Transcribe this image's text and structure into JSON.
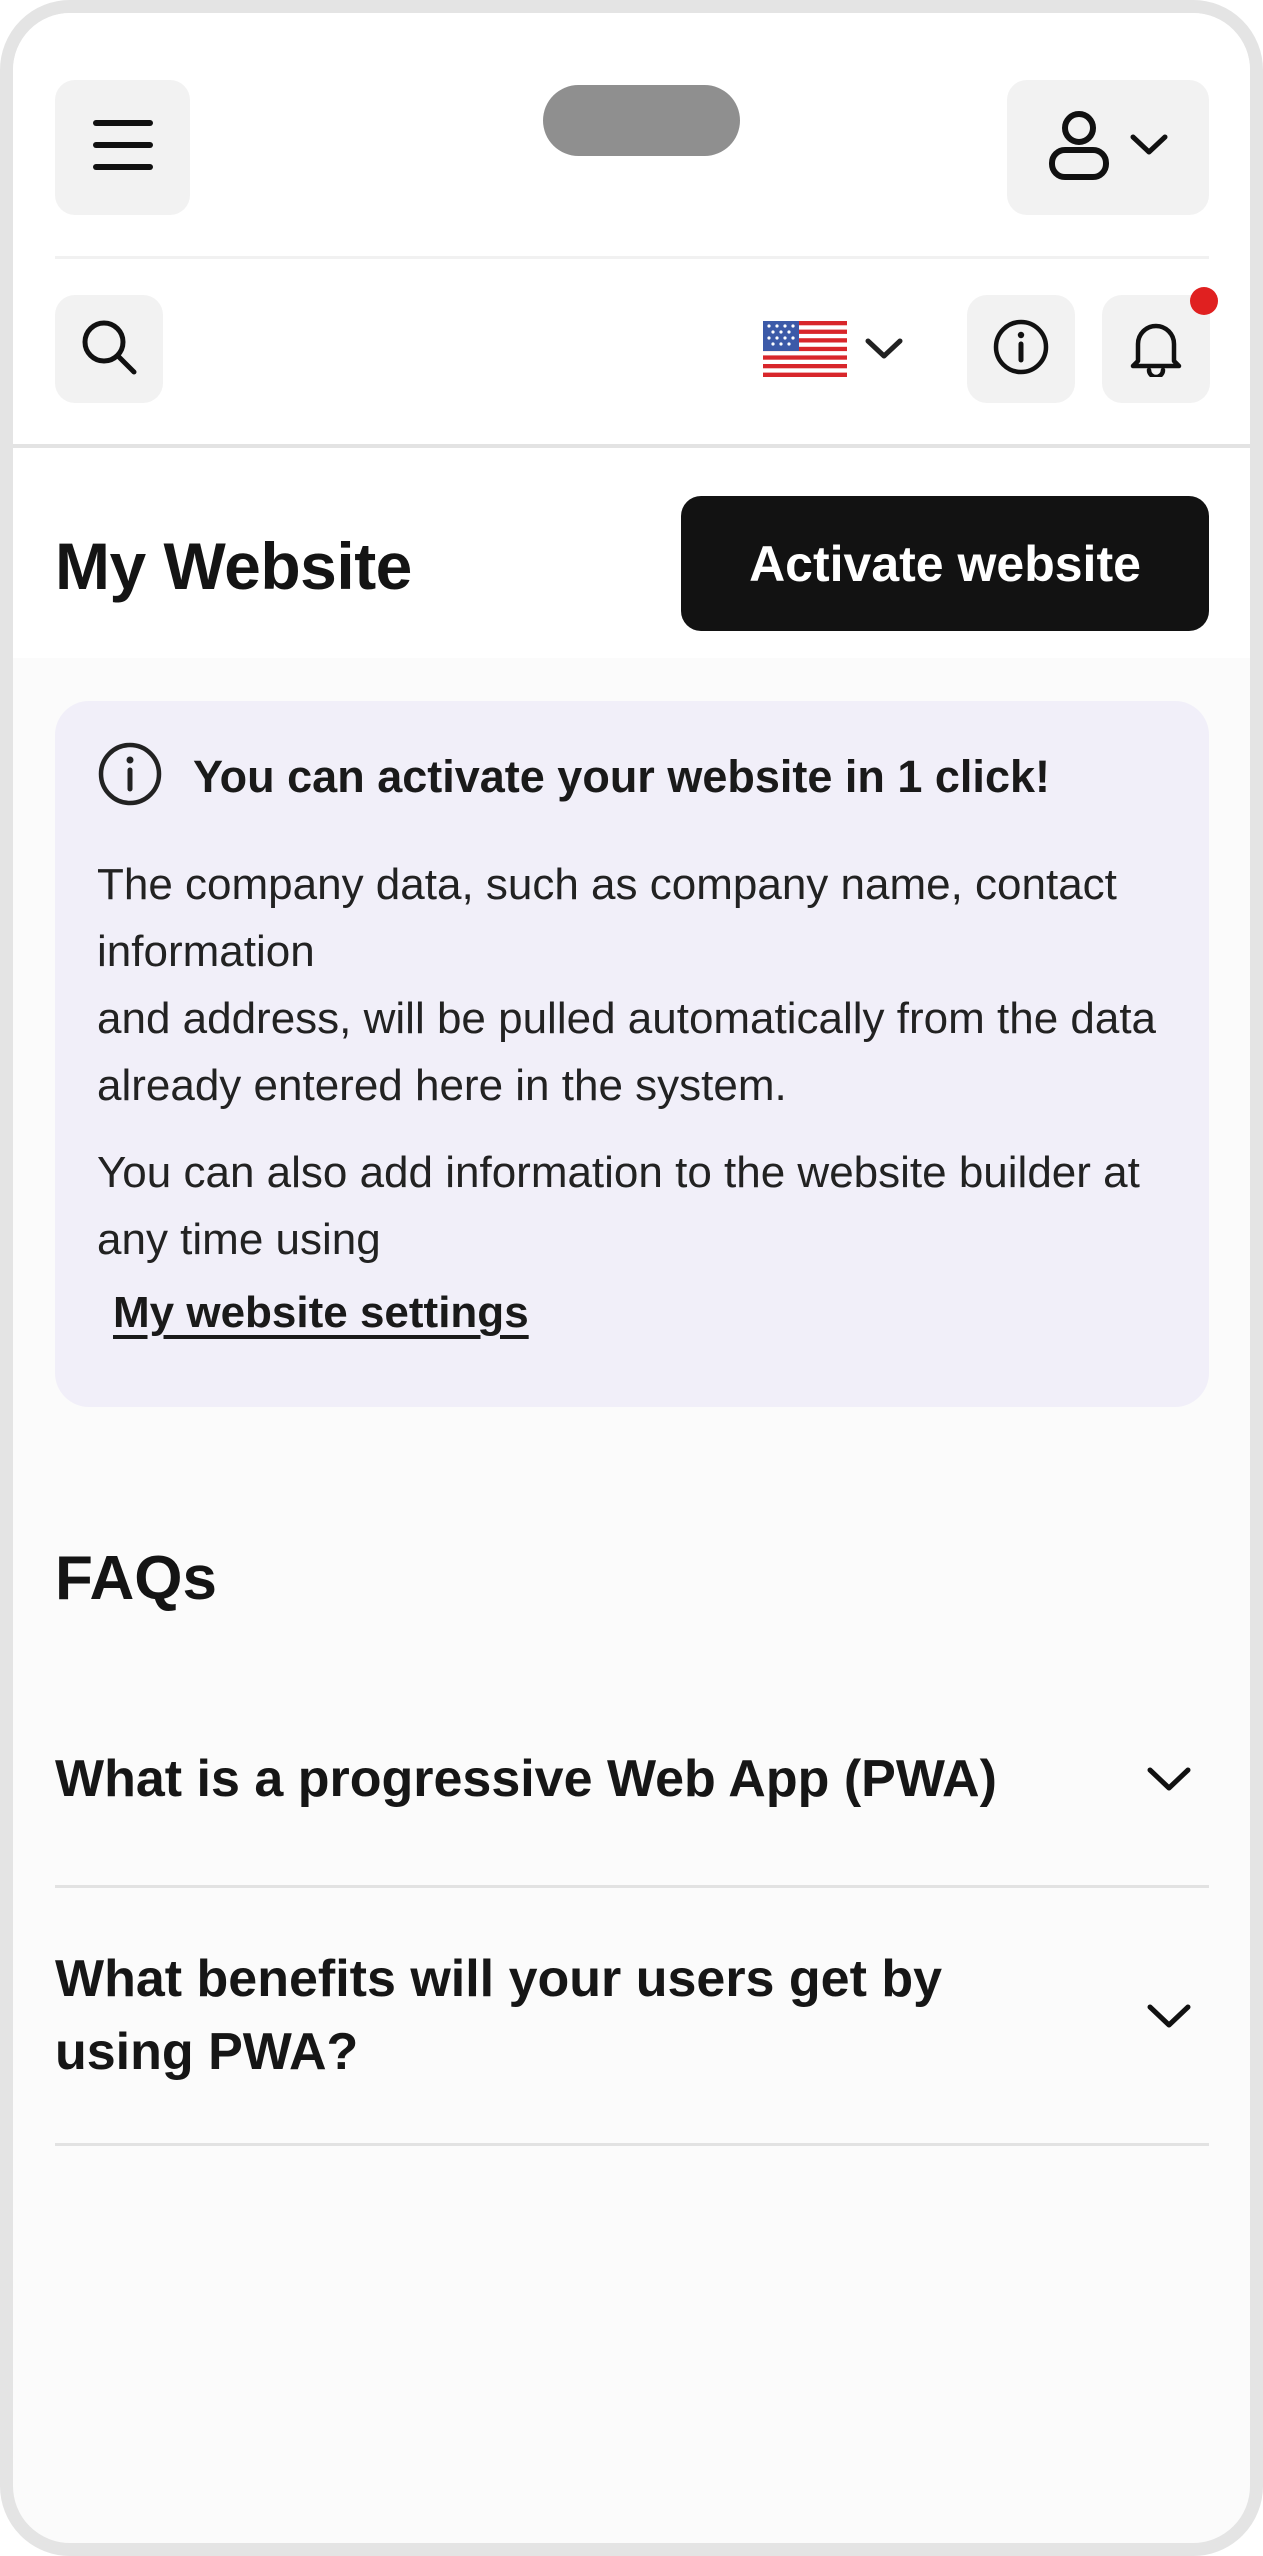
{
  "header": {
    "menu_icon": "hamburger-icon",
    "user_icon": "user-icon"
  },
  "toolbar": {
    "language_flag": "us-flag-icon",
    "notification_dot_color": "#e02020"
  },
  "page": {
    "title": "My Website",
    "activate_button": "Activate website"
  },
  "info_card": {
    "title": "You can activate your website in 1 click!",
    "paragraph1_line1": "The company data, such as company name, contact information",
    "paragraph1_line2": "and address, will be pulled automatically from the data already entered here in the system.",
    "paragraph2": "You can also add information to the website builder at any time using",
    "link": "My website settings",
    "background": "#f1eff9"
  },
  "faq": {
    "title": "FAQs",
    "items": [
      {
        "question": "What is a progressive Web App (PWA)"
      },
      {
        "question": "What benefits will your users get by using PWA?"
      }
    ]
  }
}
